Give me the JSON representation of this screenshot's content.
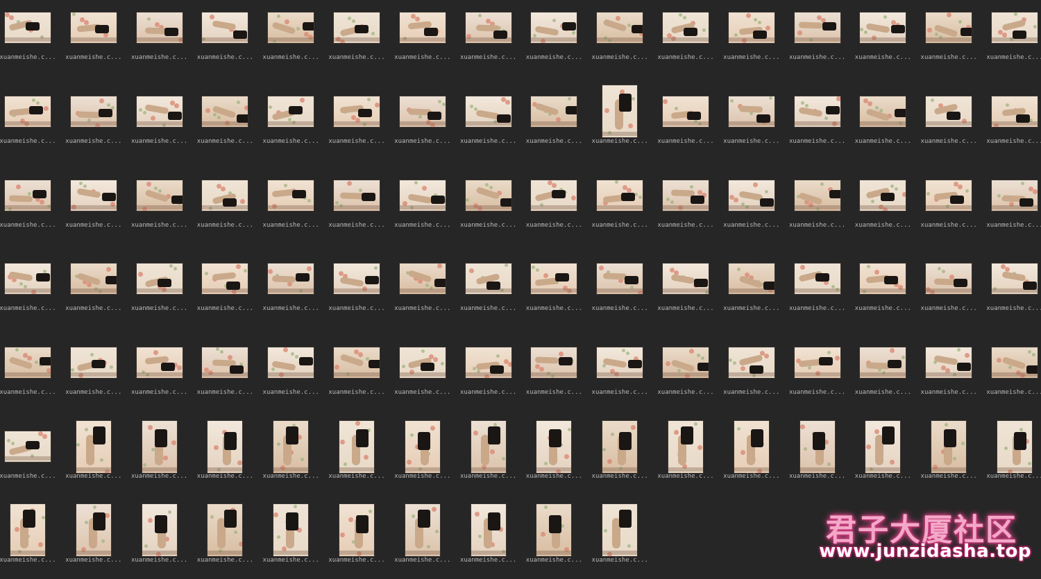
{
  "file_label": "xuanmeishe.c...",
  "rows": [
    [
      "l",
      "l",
      "l",
      "l",
      "l",
      "l",
      "l",
      "l",
      "l",
      "l",
      "l",
      "l",
      "l",
      "l",
      "l",
      "l"
    ],
    [
      "l",
      "l",
      "l",
      "l",
      "l",
      "l",
      "l",
      "l",
      "l",
      "p",
      "l",
      "l",
      "l",
      "l",
      "l",
      "l"
    ],
    [
      "l",
      "l",
      "l",
      "l",
      "l",
      "l",
      "l",
      "l",
      "l",
      "l",
      "l",
      "l",
      "l",
      "l",
      "l",
      "l"
    ],
    [
      "l",
      "l",
      "l",
      "l",
      "l",
      "l",
      "l",
      "l",
      "l",
      "l",
      "l",
      "l",
      "l",
      "l",
      "l",
      "l"
    ],
    [
      "l",
      "l",
      "l",
      "l",
      "l",
      "l",
      "l",
      "l",
      "l",
      "l",
      "l",
      "l",
      "l",
      "l",
      "l",
      "l"
    ],
    [
      "l",
      "p",
      "p",
      "p",
      "p",
      "p",
      "p",
      "p",
      "p",
      "p",
      "p",
      "p",
      "p",
      "p",
      "p",
      "p"
    ],
    [
      "p",
      "p",
      "p",
      "p",
      "p",
      "p",
      "p",
      "p",
      "p",
      "p"
    ]
  ],
  "watermark": {
    "title": "君子大厦社区",
    "url": "www.junzidasha.top"
  },
  "colors": {
    "background": "#262626",
    "label": "#b8b8b8",
    "watermark_glow": "#ff4fa0"
  }
}
